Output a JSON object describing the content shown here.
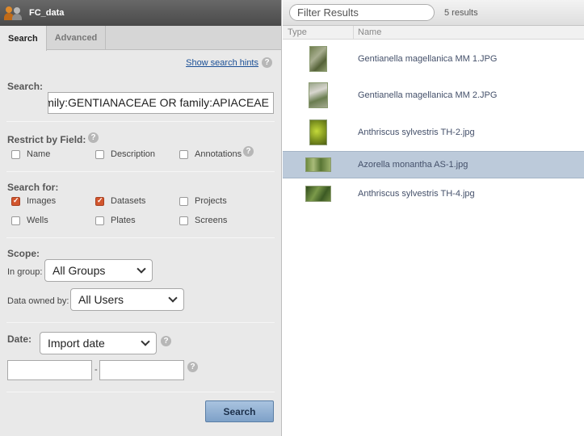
{
  "header": {
    "title": "FC_data"
  },
  "tabs": [
    {
      "label": "Search",
      "active": true
    },
    {
      "label": "Advanced",
      "active": false
    }
  ],
  "hint_link": "Show search hints",
  "help_glyph": "?",
  "search": {
    "label": "Search:",
    "value": "family:GENTIANACEAE OR family:APIACEAE"
  },
  "restrict": {
    "label": "Restrict by Field:",
    "options": [
      {
        "label": "Name",
        "checked": false
      },
      {
        "label": "Description",
        "checked": false
      },
      {
        "label": "Annotations",
        "checked": false
      }
    ]
  },
  "search_for": {
    "label": "Search for:",
    "options": [
      {
        "label": "Images",
        "checked": true
      },
      {
        "label": "Datasets",
        "checked": true
      },
      {
        "label": "Projects",
        "checked": false
      },
      {
        "label": "Wells",
        "checked": false
      },
      {
        "label": "Plates",
        "checked": false
      },
      {
        "label": "Screens",
        "checked": false
      }
    ]
  },
  "scope": {
    "label": "Scope:",
    "group_label": "In group:",
    "group_value": "All Groups",
    "owner_label": "Data owned by:",
    "owner_value": "All Users"
  },
  "date": {
    "label": "Date:",
    "type_value": "Import date",
    "range_separator": "-",
    "from_value": "",
    "to_value": ""
  },
  "search_button": "Search",
  "results": {
    "filter_placeholder": "Filter Results",
    "count": "5 results",
    "columns": {
      "type": "Type",
      "name": "Name"
    },
    "rows": [
      {
        "name": "Gentianella magellanica MM 1.JPG",
        "selected": false,
        "thumb_color": "#7d8a5a"
      },
      {
        "name": "Gentianella magellanica MM 2.JPG",
        "selected": false,
        "thumb_color": "#8a9870"
      },
      {
        "name": "Anthriscus sylvestris TH-2.jpg",
        "selected": false,
        "thumb_color": "#9bb12a"
      },
      {
        "name": "Azorella monantha AS-1.jpg",
        "selected": true,
        "thumb_color": "#5f7a3a"
      },
      {
        "name": "Anthriscus sylvestris TH-4.jpg",
        "selected": false,
        "thumb_color": "#4f6e2e"
      }
    ]
  },
  "colors": {
    "accent_button": "#7ea1c8",
    "checkbox_checked": "#d2562e",
    "selected_row": "#bccada",
    "link": "#1a4f96"
  }
}
